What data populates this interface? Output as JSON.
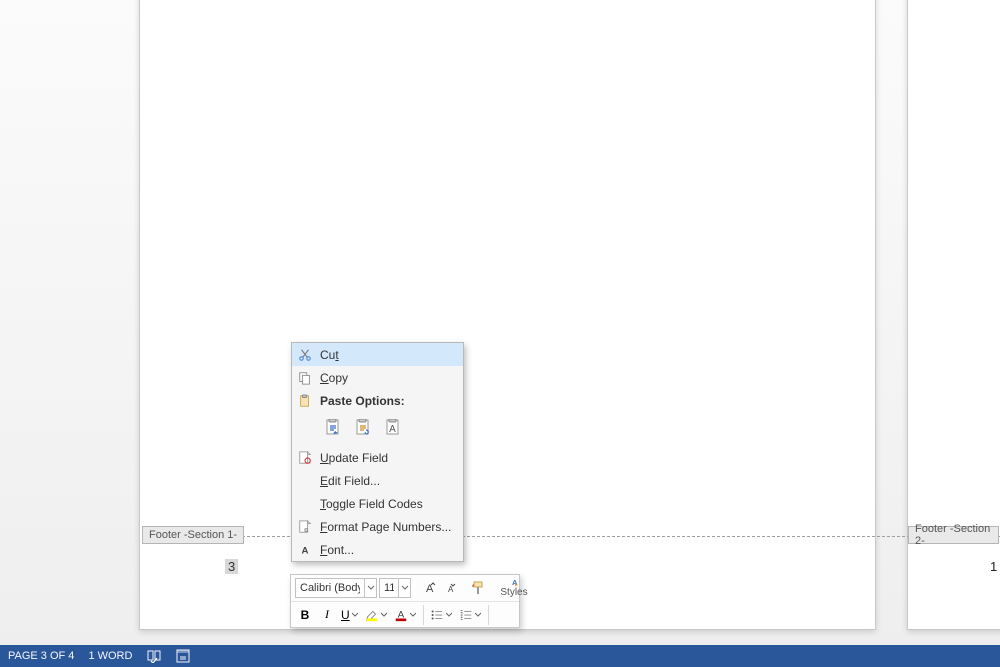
{
  "footer": {
    "tab1": "Footer -Section 1-",
    "tab2": "Footer -Section 2-",
    "page1_number": "3",
    "page2_number": "1"
  },
  "context_menu": {
    "cut": "Cut",
    "copy": "Copy",
    "paste_options": "Paste Options:",
    "update_field": "Update Field",
    "edit_field": "Edit Field...",
    "toggle_field_codes": "Toggle Field Codes",
    "format_page_numbers": "Format Page Numbers...",
    "font": "Font..."
  },
  "mini_toolbar": {
    "font_name": "Calibri (Body)",
    "font_size": "11",
    "styles": "Styles",
    "bold": "B",
    "italic": "I",
    "underline": "U"
  },
  "status_bar": {
    "page": "PAGE 3 OF 4",
    "words": "1 WORD"
  },
  "colors": {
    "accent": "#2a579a",
    "menu_highlight": "#d4e8fc",
    "font_color": "#c00000",
    "highlight": "#ffff00"
  }
}
